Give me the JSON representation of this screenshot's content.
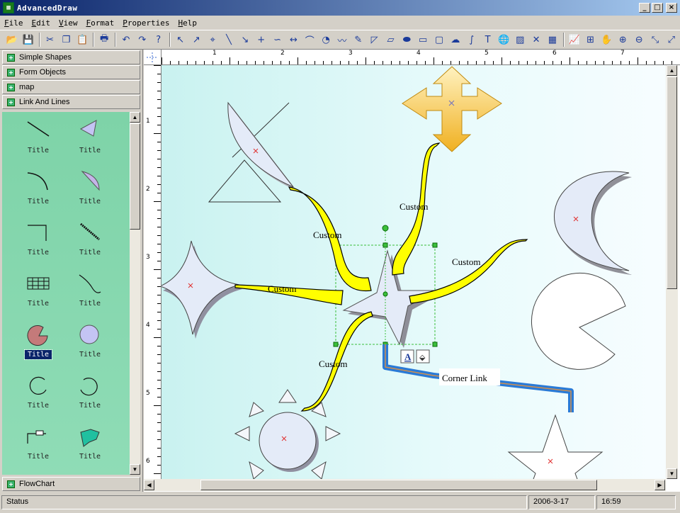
{
  "window": {
    "title": "AdvancedDraw",
    "app_icon_glyph": "▦",
    "minimize": "_",
    "maximize": "□",
    "close": "×"
  },
  "menu": [
    "File",
    "Edit",
    "View",
    "Format",
    "Properties",
    "Help"
  ],
  "toolbar": [
    {
      "name": "open-icon",
      "glyph": "📂"
    },
    {
      "name": "save-icon",
      "glyph": "💾"
    },
    {
      "sep": true
    },
    {
      "name": "cut-icon",
      "glyph": "✂"
    },
    {
      "name": "copy-icon",
      "glyph": "❐"
    },
    {
      "name": "paste-icon",
      "glyph": "📋"
    },
    {
      "sep": true
    },
    {
      "name": "print-icon",
      "glyph": "🖶"
    },
    {
      "sep": true
    },
    {
      "name": "undo-icon",
      "glyph": "↶"
    },
    {
      "name": "redo-icon",
      "glyph": "↷"
    },
    {
      "name": "help-icon",
      "glyph": "?"
    },
    {
      "sep": true
    },
    {
      "name": "select-icon",
      "glyph": "↖"
    },
    {
      "name": "select-add-icon",
      "glyph": "↗"
    },
    {
      "name": "node-edit-icon",
      "glyph": "⌖"
    },
    {
      "name": "line-icon",
      "glyph": "╲"
    },
    {
      "name": "arrow-line-icon",
      "glyph": "↘"
    },
    {
      "name": "cross-line-icon",
      "glyph": "+"
    },
    {
      "name": "bezier-icon",
      "glyph": "∽"
    },
    {
      "name": "dimension-icon",
      "glyph": "↔"
    },
    {
      "name": "arc-icon",
      "glyph": "⌒"
    },
    {
      "name": "pie-icon",
      "glyph": "◔"
    },
    {
      "name": "curve-icon",
      "glyph": "〰"
    },
    {
      "name": "freehand-icon",
      "glyph": "✎"
    },
    {
      "name": "polyline-icon",
      "glyph": "◸"
    },
    {
      "name": "parallelogram-icon",
      "glyph": "▱"
    },
    {
      "name": "ellipse-icon",
      "glyph": "⬬"
    },
    {
      "name": "rectangle-icon",
      "glyph": "▭"
    },
    {
      "name": "rounded-rect-icon",
      "glyph": "▢"
    },
    {
      "name": "blob-icon",
      "glyph": "☁"
    },
    {
      "name": "spline-icon",
      "glyph": "∫"
    },
    {
      "name": "text-icon",
      "glyph": "T"
    },
    {
      "name": "globe-icon",
      "glyph": "🌐"
    },
    {
      "name": "image-icon",
      "glyph": "▨"
    },
    {
      "name": "delete-icon",
      "glyph": "✕"
    },
    {
      "name": "table-icon",
      "glyph": "▦"
    },
    {
      "sep": true
    },
    {
      "name": "chart-icon",
      "glyph": "📈"
    },
    {
      "name": "grid-icon",
      "glyph": "⊞"
    },
    {
      "name": "pan-hand-icon",
      "glyph": "✋"
    },
    {
      "name": "zoom-in-icon",
      "glyph": "⊕"
    },
    {
      "name": "zoom-out-icon",
      "glyph": "⊖"
    },
    {
      "name": "connector-icon",
      "glyph": "⤡"
    },
    {
      "name": "link-icon",
      "glyph": "⤢"
    }
  ],
  "sidebar": {
    "categories": [
      "Simple Shapes",
      "Form Objects",
      "map",
      "Link And Lines"
    ],
    "bottom_category": "FlowChart",
    "items": [
      "Title",
      "Title",
      "Title",
      "Title",
      "Title",
      "Title",
      "Title",
      "Title",
      "Title",
      "Title",
      "Title",
      "Title",
      "Title",
      "Title"
    ],
    "selected_index": 8
  },
  "ruler": {
    "top": [
      "1",
      "2",
      "3",
      "4",
      "5",
      "6",
      "7"
    ],
    "left": [
      "1",
      "2",
      "3",
      "4",
      "5",
      "6"
    ]
  },
  "canvas": {
    "labels": {
      "custom_top": "Custom",
      "custom_left": "Custom",
      "custom_mid_left": "Custom",
      "custom_right": "Custom",
      "custom_bottom": "Custom",
      "corner_link": "Corner Link"
    },
    "colors": {
      "link_fill": "#ffff00",
      "shape_fill": "#e4ebf8",
      "corner_link": "#3a8de0",
      "star_arrow": "#ffd060"
    }
  },
  "status": {
    "label": "Status",
    "date": "2006-3-17",
    "time": "16:59"
  }
}
